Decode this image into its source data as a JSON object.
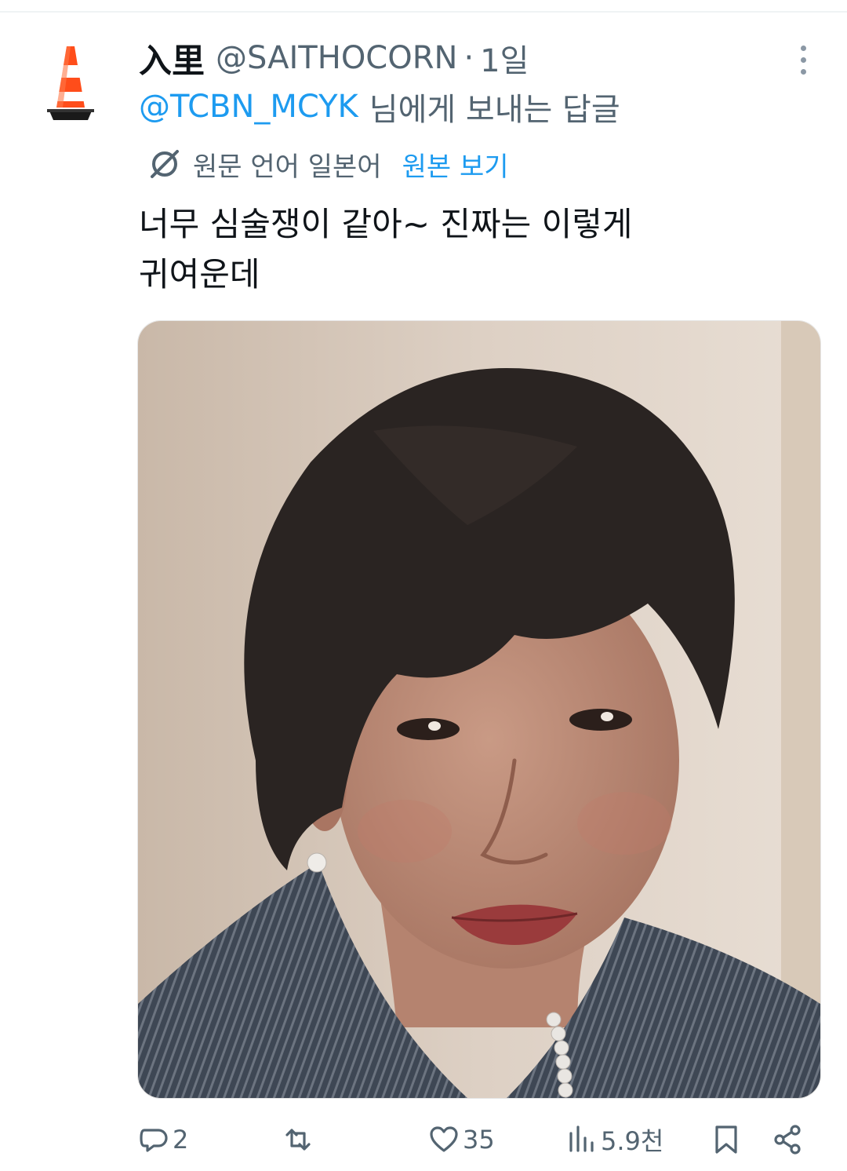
{
  "tweet": {
    "display_name": "入里",
    "handle": "@SAITHOCORN",
    "separator": "·",
    "time": "1일",
    "reply_mention": "@TCBN_MCYK",
    "reply_suffix": "님에게 보내는 답글",
    "translation_note": "원문 언어 일본어",
    "show_original": "원본 보기",
    "text_line1": "너무 심술쟁이 같아~ 진짜는 이렇게",
    "text_line2": "귀여운데"
  },
  "actions": {
    "replies": "2",
    "retweets": "",
    "likes": "35",
    "views": "5.9천"
  },
  "icons": {
    "avatar": "traffic-cone-icon",
    "translate": "globe-slash-icon",
    "more": "more-vertical-icon",
    "reply": "reply-bubble-icon",
    "retweet": "retweet-icon",
    "like": "heart-icon",
    "views": "bar-chart-icon",
    "bookmark": "bookmark-icon",
    "share": "share-icon"
  },
  "colors": {
    "link": "#1d9bf0",
    "secondary_text": "#536471",
    "primary_text": "#0f1419",
    "cone": "#ff4d1a"
  }
}
